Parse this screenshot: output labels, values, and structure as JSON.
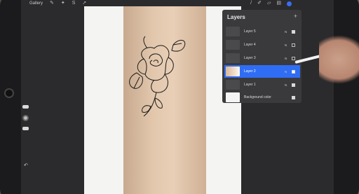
{
  "toolbar": {
    "gallery_label": "Gallery"
  },
  "panel": {
    "title": "Layers",
    "add_icon": "plus-icon",
    "layers": [
      {
        "name": "Layer 5",
        "blend": "N",
        "visible": true,
        "active": false
      },
      {
        "name": "Layer 4",
        "blend": "N",
        "visible": false,
        "active": false
      },
      {
        "name": "Layer 3",
        "blend": "N",
        "visible": false,
        "active": false
      },
      {
        "name": "Layer 2",
        "blend": "N",
        "visible": true,
        "active": true
      },
      {
        "name": "Layer 1",
        "blend": "N",
        "visible": true,
        "active": false
      },
      {
        "name": "Background color",
        "blend": "",
        "visible": true,
        "active": false
      }
    ]
  },
  "colors": {
    "accent": "#2f6df5",
    "panel": "#3a3a3c",
    "canvas": "#f4f4f2"
  }
}
